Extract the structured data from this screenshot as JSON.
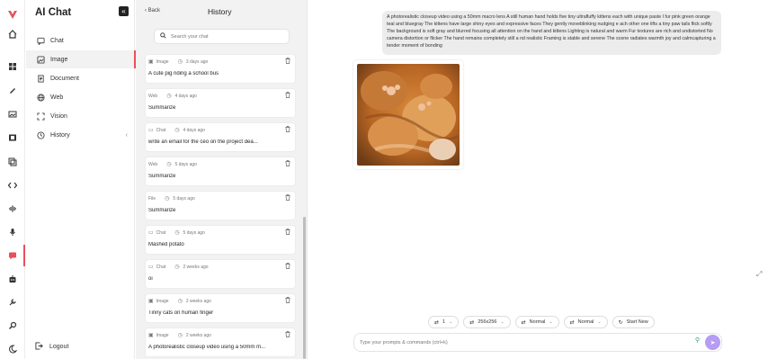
{
  "app": {
    "title": "AI Chat",
    "collapse_label": "«"
  },
  "sidebar": {
    "items": [
      {
        "label": "Chat",
        "icon": "chat-bubble-icon"
      },
      {
        "label": "Image",
        "icon": "image-icon"
      },
      {
        "label": "Document",
        "icon": "document-icon"
      },
      {
        "label": "Web",
        "icon": "globe-icon"
      },
      {
        "label": "Vision",
        "icon": "vision-icon"
      },
      {
        "label": "History",
        "icon": "history-icon"
      }
    ],
    "logout_label": "Logout"
  },
  "history": {
    "back_label": "Back",
    "title": "History",
    "search_placeholder": "Search your chat",
    "items": [
      {
        "type": "Image",
        "time": "3 days ago",
        "text": "A cute pig riding a school bus"
      },
      {
        "type": "Web",
        "time": "4 days ago",
        "text": "Summarize"
      },
      {
        "type": "Chat",
        "time": "4 days ago",
        "text": "write an email for the ceo on the project dea..."
      },
      {
        "type": "Web",
        "time": "5 days ago",
        "text": "Summarize"
      },
      {
        "type": "File",
        "time": "5 days ago",
        "text": "Summarize"
      },
      {
        "type": "Chat",
        "time": "5 days ago",
        "text": "Mashed potato"
      },
      {
        "type": "Chat",
        "time": "2 weeks ago",
        "text": "oi"
      },
      {
        "type": "Image",
        "time": "2 weeks ago",
        "text": "Tinny cats on human finger"
      },
      {
        "type": "Image",
        "time": "2 weeks ago",
        "text": "A photorealistic closeup video using a 50mm m..."
      }
    ]
  },
  "chat": {
    "user_message": "A photorealistic closeup video using a 50mm macro lens A still human hand holds five tiny ultrafluffy kittens each with unique paste l fur pink green orange teal and bluegray The kittens have large shiny eyes and expressive faces They gently moveblinking nudging e ach other one lifts a tiny paw tails flick softly The background is soft gray and blurred focusing all attention on the hand and kittens Lighting is natural and warm Fur textures are rich and undistorted No camera distortion or flicker The hand remains completely still a nd realistic Framing is stable and serene The scene radiates warmth joy and calmcapturing a tender moment of bonding",
    "image_alt": "orange kitten closeup"
  },
  "controls": {
    "count": "1",
    "size": "256x256",
    "quality": "Normal",
    "style": "Normal",
    "start_new": "Start New"
  },
  "prompt": {
    "placeholder": "Type your prompts & commands (ctrl+k)"
  },
  "colors": {
    "accent": "#e8505b",
    "send": "#b59cf5"
  }
}
